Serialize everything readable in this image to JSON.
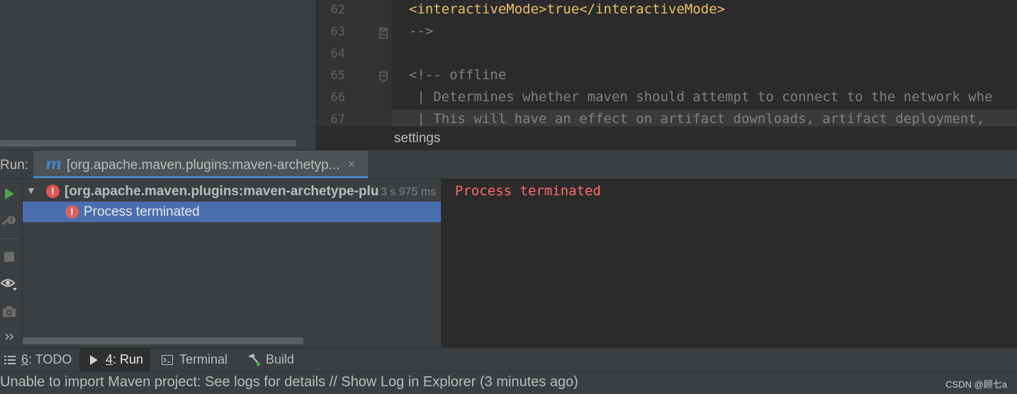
{
  "editor": {
    "lines": [
      {
        "number": "62",
        "text": "<interactiveMode>true</interactiveMode>",
        "style": "tag"
      },
      {
        "number": "63",
        "text": "-->",
        "style": "comment"
      },
      {
        "number": "64",
        "text": "",
        "style": "comment"
      },
      {
        "number": "65",
        "text": "<!-- offline",
        "style": "comment"
      },
      {
        "number": "66",
        "text": " | Determines whether maven should attempt to connect to the network whe",
        "style": "comment"
      },
      {
        "number": "67",
        "text": " | This will have an effect on artifact downloads, artifact deployment,",
        "style": "comment"
      }
    ],
    "breadcrumb": "settings"
  },
  "run_window": {
    "label": "Run:",
    "tab": {
      "icon": "maven-icon",
      "icon_glyph": "m",
      "title": "[org.apache.maven.plugins:maven-archetyp...",
      "close_glyph": "×"
    },
    "toolbar": [
      {
        "name": "rerun-icon",
        "glyph": "▶",
        "color": "#4ca24c"
      },
      {
        "name": "debug-icon",
        "glyph": "✎",
        "color": "#6b6b6b"
      },
      {
        "name": "stop-icon",
        "glyph": "■",
        "color": "#6b6b6b"
      },
      {
        "name": "view-options-icon",
        "glyph": "◉",
        "color": "#bbbbbb"
      },
      {
        "name": "screenshot-icon",
        "glyph": "📷",
        "color": "#6b6b6b"
      },
      {
        "name": "more-icon",
        "glyph": "»",
        "color": "#bbbbbb"
      }
    ],
    "tree": {
      "root": {
        "title": "[org.apache.maven.plugins:maven-archetype-plu",
        "time": "3 s 975 ms",
        "icon": "error-icon"
      },
      "child": {
        "label": "Process terminated",
        "icon": "error-icon"
      }
    },
    "console": {
      "text": "Process terminated",
      "color": "#ff6b68"
    }
  },
  "tool_windows": [
    {
      "id": "todo",
      "num": "6",
      "label": ": TODO",
      "icon": "list-icon"
    },
    {
      "id": "run",
      "num": "4",
      "label": ": Run",
      "icon": "play-icon",
      "active": true
    },
    {
      "id": "terminal",
      "num": "",
      "label": "Terminal",
      "icon": "terminal-icon"
    },
    {
      "id": "build",
      "num": "",
      "label": "Build",
      "icon": "hammer-icon"
    }
  ],
  "status": {
    "message": "Unable to import Maven project: See logs for details // Show Log in Explorer (3 minutes ago)",
    "watermark": "CSDN @顾七a"
  },
  "colors": {
    "error": "#e05555",
    "selection": "#4b6eaf",
    "tab_accent": "#4a88c7"
  }
}
